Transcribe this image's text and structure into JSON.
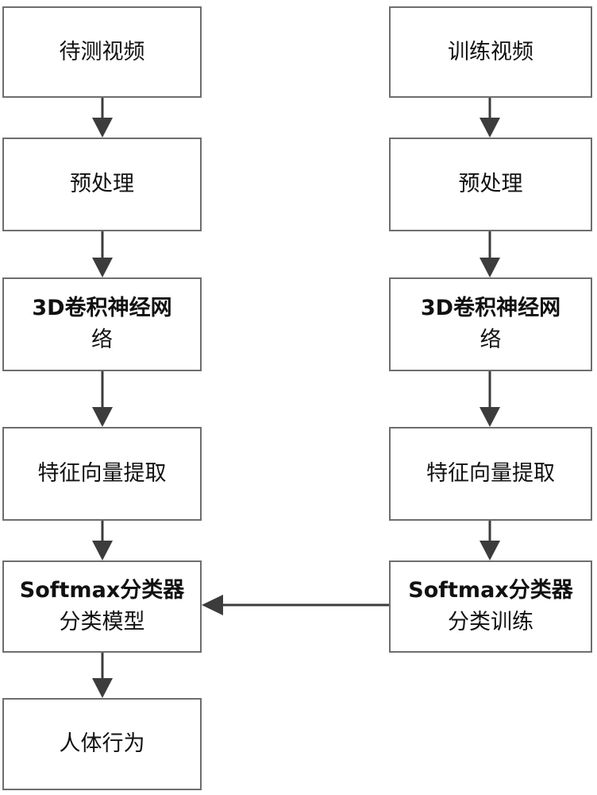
{
  "left_column": [
    {
      "id": "test-video",
      "lines": [
        "待测视频"
      ]
    },
    {
      "id": "preprocess",
      "lines": [
        "预处理"
      ]
    },
    {
      "id": "3d-cnn",
      "lines": [
        "3D卷积神经网",
        "络"
      ]
    },
    {
      "id": "feature-extract",
      "lines": [
        "特征向量提取"
      ]
    },
    {
      "id": "softmax-model",
      "lines": [
        "Softmax分类器",
        "分类模型"
      ]
    },
    {
      "id": "human-behavior",
      "lines": [
        "人体行为"
      ]
    }
  ],
  "right_column": [
    {
      "id": "train-video",
      "lines": [
        "训练视频"
      ]
    },
    {
      "id": "preprocess",
      "lines": [
        "预处理"
      ]
    },
    {
      "id": "3d-cnn",
      "lines": [
        "3D卷积神经网",
        "络"
      ]
    },
    {
      "id": "feature-extract",
      "lines": [
        "特征向量提取"
      ]
    },
    {
      "id": "softmax-train",
      "lines": [
        "Softmax分类器",
        "分类训练"
      ]
    }
  ],
  "edges": [
    {
      "from": "right.softmax-train",
      "to": "left.softmax-model",
      "direction": "left"
    }
  ],
  "colors": {
    "border": "#6e6e6e",
    "arrow": "#3c3c3c"
  }
}
